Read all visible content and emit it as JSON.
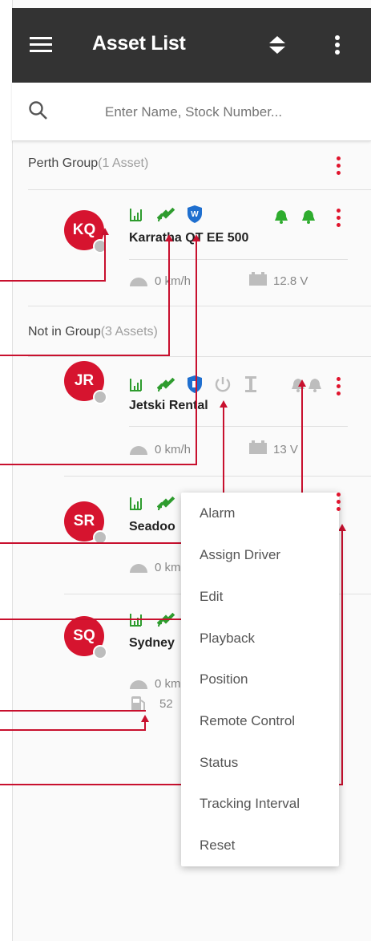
{
  "header": {
    "title": "Asset List",
    "menu_icon": "hamburger-menu-icon",
    "sort_icon": "sort-icon",
    "more_icon": "more-vert-icon"
  },
  "search": {
    "placeholder": "Enter Name, Stock Number...",
    "icon": "search-icon"
  },
  "groups": [
    {
      "name": "Perth Group",
      "count": "(1 Asset)"
    },
    {
      "name": "Not in Group",
      "count": "(3 Assets)"
    }
  ],
  "assets": [
    {
      "initials": "KQ",
      "name": "Karratha QT EE 500",
      "speed": "0 km/h",
      "voltage": "12.8 V"
    },
    {
      "initials": "JR",
      "name": "Jetski Rental",
      "speed": "0 km/h",
      "voltage": "13 V"
    },
    {
      "initials": "SR",
      "name": "Seadoo",
      "speed": "0 km"
    },
    {
      "initials": "SQ",
      "name": "Sydney",
      "speed": "0 km",
      "fuel": "52"
    }
  ],
  "context_menu": {
    "items": [
      "Alarm",
      "Assign Driver",
      "Edit",
      "Playback",
      "Position",
      "Remote Control",
      "Status",
      "Tracking Interval",
      "Reset"
    ]
  },
  "colors": {
    "appbar": "#333333",
    "accent_red": "#d6142f",
    "green": "#2e9c2e",
    "blue": "#1f6fcf"
  }
}
